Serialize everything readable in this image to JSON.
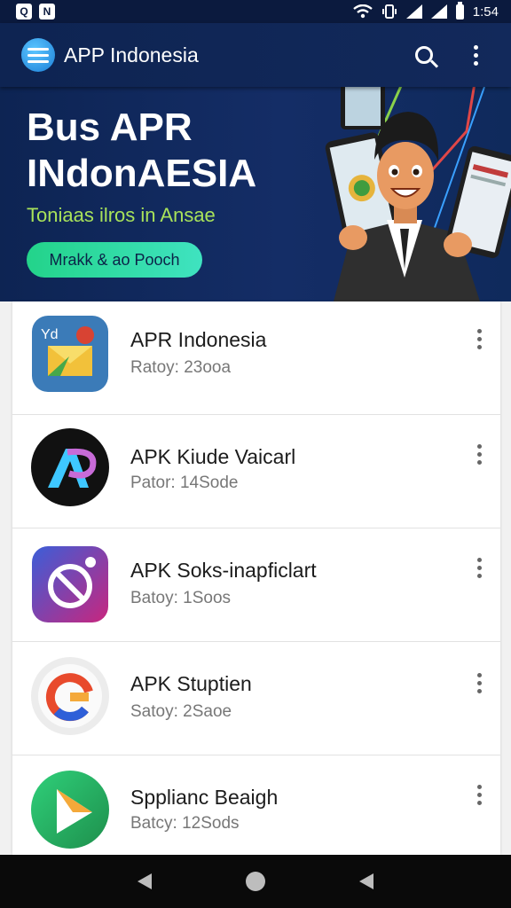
{
  "status_bar": {
    "left_icons": [
      "Q",
      "N"
    ],
    "time": "1:54",
    "icons": [
      "wifi-icon",
      "vibrate-icon",
      "signal-icon",
      "battery-icon"
    ]
  },
  "app_bar": {
    "title": "APP Indonesia",
    "icons": [
      "app-logo-icon",
      "search-icon",
      "more-vert-icon"
    ]
  },
  "banner": {
    "title_line1": "Bus APR",
    "title_line2": "INdonAESIA",
    "subtitle": "Toniaas ilros in Ansae",
    "cta_label": "Mrakk & ao Pooch"
  },
  "apps": [
    {
      "name": "APR Indonesia",
      "meta": "Ratoy: 23ooa",
      "icon": "mail-app-icon"
    },
    {
      "name": "APK Kiude Vaicarl",
      "meta": "Pator: 14Sode",
      "icon": "ap-app-icon"
    },
    {
      "name": "APK Soks-inapficlart",
      "meta": "Batoy: 1Soos",
      "icon": "camera-app-icon"
    },
    {
      "name": "APK Stuptien",
      "meta": "Satoy: 2Saoe",
      "icon": "g-app-icon"
    },
    {
      "name": "Spplianc Beaigh",
      "meta": "Batcy: 12Sods",
      "icon": "play-app-icon"
    }
  ],
  "colors": {
    "header_bg": "#0e2452",
    "banner_bg": "#142d66",
    "subtitle": "#a8e25a",
    "cta_gradient_start": "#23d38a",
    "cta_gradient_end": "#3fe3c0",
    "nav_bg": "#0a0a0a"
  },
  "nav_bar": {
    "icons": [
      "back-icon",
      "home-icon",
      "recents-icon"
    ]
  }
}
